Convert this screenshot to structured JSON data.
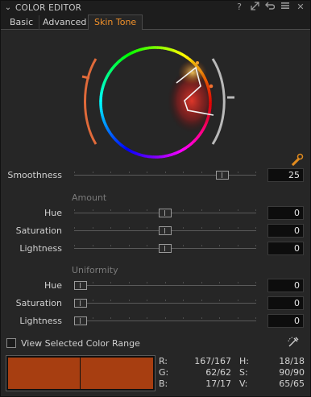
{
  "panel": {
    "title": "COLOR EDITOR",
    "tools": [
      "help-icon",
      "expand-icon",
      "reset-icon",
      "menu-icon",
      "close-icon"
    ]
  },
  "tabs": [
    {
      "label": "Basic",
      "active": false
    },
    {
      "label": "Advanced",
      "active": false
    },
    {
      "label": "Skin Tone",
      "active": true
    }
  ],
  "smoothness": {
    "label": "Smoothness",
    "value": "25",
    "level": 0.84
  },
  "amount": {
    "title": "Amount",
    "rows": [
      {
        "label": "Hue",
        "value": "0",
        "level": 0.5
      },
      {
        "label": "Saturation",
        "value": "0",
        "level": 0.5
      },
      {
        "label": "Lightness",
        "value": "0",
        "level": 0.5
      }
    ]
  },
  "uniformity": {
    "title": "Uniformity",
    "rows": [
      {
        "label": "Hue",
        "value": "0",
        "level": 0.0
      },
      {
        "label": "Saturation",
        "value": "0",
        "level": 0.0
      },
      {
        "label": "Lightness",
        "value": "0",
        "level": 0.0
      }
    ]
  },
  "view_range": {
    "label": "View Selected Color Range",
    "checked": false
  },
  "swatch_color": "#a73e11",
  "readout": {
    "R": {
      "k": "R:",
      "v": "167/167"
    },
    "G": {
      "k": "G:",
      "v": "62/62"
    },
    "B": {
      "k": "B:",
      "v": "17/17"
    },
    "H": {
      "k": "H:",
      "v": "18/18"
    },
    "S": {
      "k": "S:",
      "v": "90/90"
    },
    "V": {
      "k": "V:",
      "v": "65/65"
    }
  },
  "colors": {
    "accent": "#f0902a",
    "swatch": "#a73e11"
  }
}
